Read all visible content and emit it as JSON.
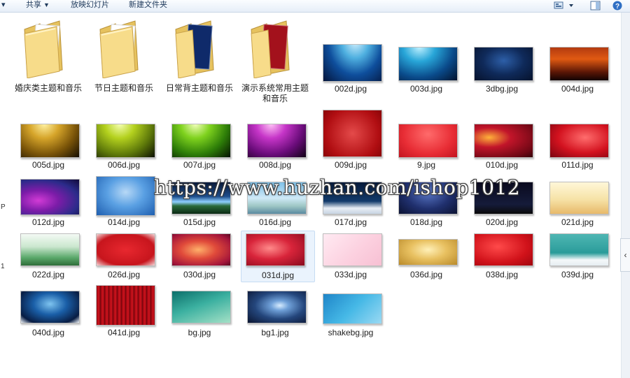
{
  "toolbar": {
    "share_label": "共享",
    "slideshow_label": "放映幻灯片",
    "new_folder_label": "新建文件夹"
  },
  "left_edge": {
    "chars": [
      "P",
      "1"
    ]
  },
  "files": [
    {
      "name": "婚庆类主题和音乐",
      "type": "folder"
    },
    {
      "name": "节日主题和音乐",
      "type": "folder"
    },
    {
      "name": "日常背主题和音乐",
      "type": "folder"
    },
    {
      "name": "演示系统常用主题和音乐",
      "type": "folder"
    },
    {
      "name": "002d.jpg",
      "type": "image"
    },
    {
      "name": "003d.jpg",
      "type": "image"
    },
    {
      "name": "3dbg.jpg",
      "type": "image"
    },
    {
      "name": "004d.jpg",
      "type": "image"
    },
    {
      "name": "005d.jpg",
      "type": "image"
    },
    {
      "name": "006d.jpg",
      "type": "image"
    },
    {
      "name": "007d.jpg",
      "type": "image"
    },
    {
      "name": "008d.jpg",
      "type": "image"
    },
    {
      "name": "009d.jpg",
      "type": "image"
    },
    {
      "name": "9.jpg",
      "type": "image"
    },
    {
      "name": "010d.jpg",
      "type": "image"
    },
    {
      "name": "011d.jpg",
      "type": "image"
    },
    {
      "name": "012d.jpg",
      "type": "image"
    },
    {
      "name": "014d.jpg",
      "type": "image"
    },
    {
      "name": "015d.jpg",
      "type": "image"
    },
    {
      "name": "016d.jpg",
      "type": "image"
    },
    {
      "name": "017d.jpg",
      "type": "image"
    },
    {
      "name": "018d.jpg",
      "type": "image"
    },
    {
      "name": "020d.jpg",
      "type": "image"
    },
    {
      "name": "021d.jpg",
      "type": "image"
    },
    {
      "name": "022d.jpg",
      "type": "image"
    },
    {
      "name": "026d.jpg",
      "type": "image"
    },
    {
      "name": "030d.jpg",
      "type": "image"
    },
    {
      "name": "031d.jpg",
      "type": "image",
      "selected": true
    },
    {
      "name": "033d.jpg",
      "type": "image"
    },
    {
      "name": "036d.jpg",
      "type": "image"
    },
    {
      "name": "038d.jpg",
      "type": "image"
    },
    {
      "name": "039d.jpg",
      "type": "image"
    },
    {
      "name": "040d.jpg",
      "type": "image"
    },
    {
      "name": "041d.jpg",
      "type": "image"
    },
    {
      "name": "bg.jpg",
      "type": "image"
    },
    {
      "name": "bg1.jpg",
      "type": "image"
    },
    {
      "name": "shakebg.jpg",
      "type": "image"
    }
  ],
  "watermark": "https://www.huzhan.com/ishop1012"
}
